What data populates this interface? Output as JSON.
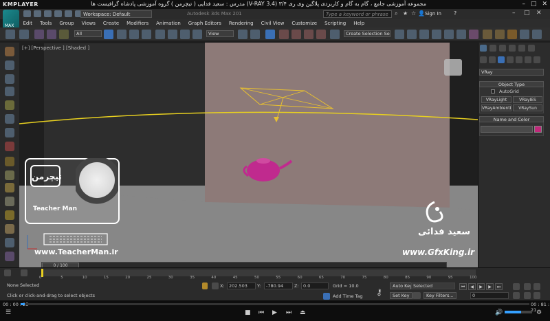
{
  "player": {
    "name": "KMPLAYER",
    "title": "مجموعه آموزشی جامع ، گام به گام و کاربردی پلاگین وی ری ۳/۴ (V-RAY 3.4)  مدرس : سعید فدایی ( تیچرمن ) گروه آموزشی پادشاه گرافیست ها",
    "time_elapsed": "00 : 00 : 25",
    "time_total": "00 : 81 : 21",
    "progress_fraction": 0.008
  },
  "max": {
    "logo_text": "MAX",
    "workspace": "Workspace: Default",
    "app_title": "Autodesk 3ds Max 201",
    "search_placeholder": "Type a keyword or phrase",
    "sign_in": "Sign In",
    "menus": [
      "Edit",
      "Tools",
      "Group",
      "Views",
      "Create",
      "Modifiers",
      "Animation",
      "Graph Editors",
      "Rendering",
      "Civil View",
      "Customize",
      "Scripting",
      "Help"
    ],
    "toolbar": {
      "filter": "All",
      "refcoord": "View",
      "selection_set": "Create Selection Se"
    },
    "viewport_label": "[+] [Perspective ] [Shaded ]",
    "time_slider": "0 / 100"
  },
  "command_panel": {
    "renderer_dropdown": "VRay",
    "object_type_header": "Object Type",
    "autogrid": "AutoGrid",
    "buttons": [
      "VRayLight",
      "VRayIES",
      "VRayAmbientLig",
      "VRaySun"
    ],
    "name_color_header": "Name and Color",
    "color": "#c0297a"
  },
  "timeline": {
    "ticks": [
      "0",
      "5",
      "10",
      "15",
      "20",
      "25",
      "30",
      "35",
      "40",
      "45",
      "50",
      "55",
      "60",
      "65",
      "70",
      "75",
      "80",
      "85",
      "90",
      "95",
      "100"
    ]
  },
  "status": {
    "selection": "None Selected",
    "prompt": "Click or click-and-drag to select objects",
    "x_label": "X:",
    "x_value": "202.503",
    "y_label": "Y:",
    "y_value": "-780.94",
    "z_label": "Z:",
    "z_value": "0.0",
    "grid": "Grid = 10.0",
    "add_time_tag": "Add Time Tag",
    "auto_key": "Auto Key",
    "auto_key_dropdown": "Selected",
    "set_key": "Set Key",
    "key_filters": "Key Filters...",
    "frame_value": "0"
  },
  "overlays": {
    "teacherman_url": "www.TeacherMan.ir",
    "teacherman_name": "Teacher Man",
    "teacherman_logo_fa": "تیچرمن",
    "gfxking_url": "www.GfxKing.ir",
    "gfxking_name_fa": "سعید فدائی"
  }
}
